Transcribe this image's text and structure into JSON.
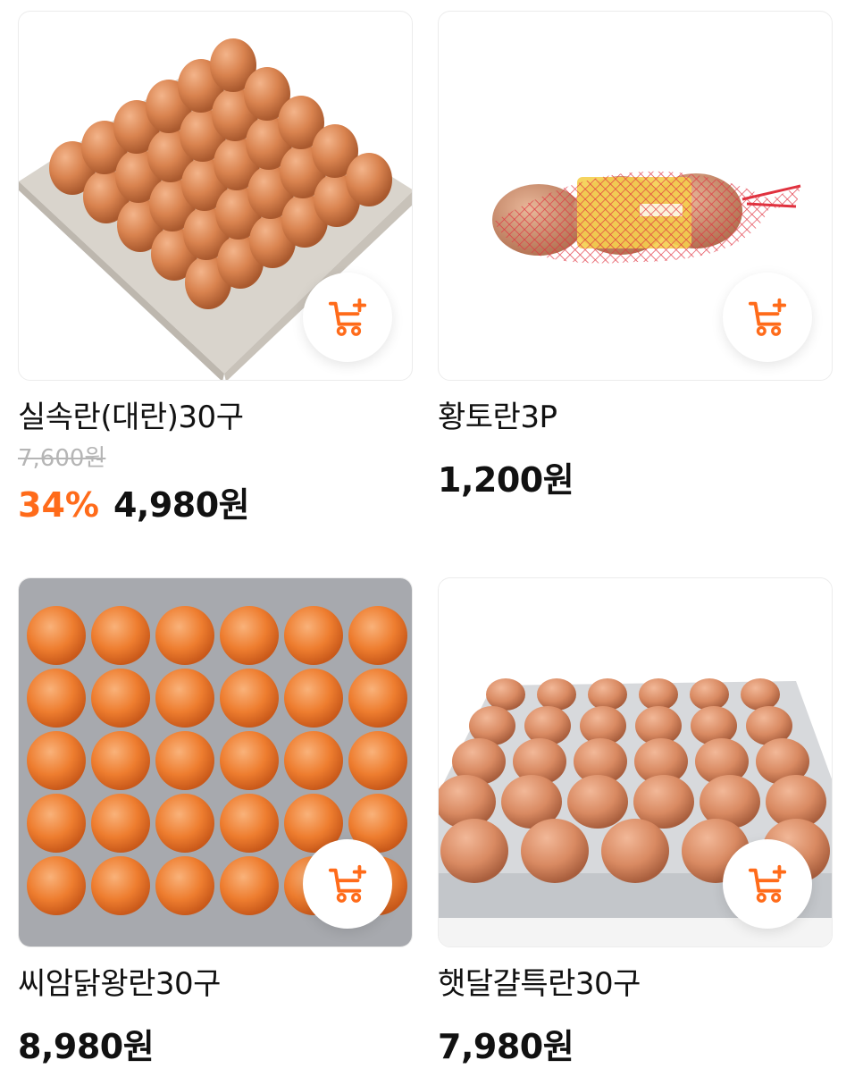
{
  "colors": {
    "accent": "#ff6b1a",
    "text": "#111111",
    "strike": "#b5b5b5"
  },
  "products": [
    {
      "name": "실속란(대란)30구",
      "original_price": "7,600원",
      "discount": "34%",
      "price": "4,980원",
      "image": "egg-tray-30-brown-angled",
      "cart_icon": "cart-add-icon"
    },
    {
      "name": "황토란3P",
      "price": "1,200원",
      "image": "eggs-in-red-net",
      "cart_icon": "cart-add-icon"
    },
    {
      "name": "씨암닭왕란30구",
      "price": "8,980원",
      "image": "egg-tray-30-topdown",
      "cart_icon": "cart-add-icon"
    },
    {
      "name": "햇달걀특란30구",
      "price": "7,980원",
      "image": "egg-tray-30-side",
      "cart_icon": "cart-add-icon"
    }
  ]
}
